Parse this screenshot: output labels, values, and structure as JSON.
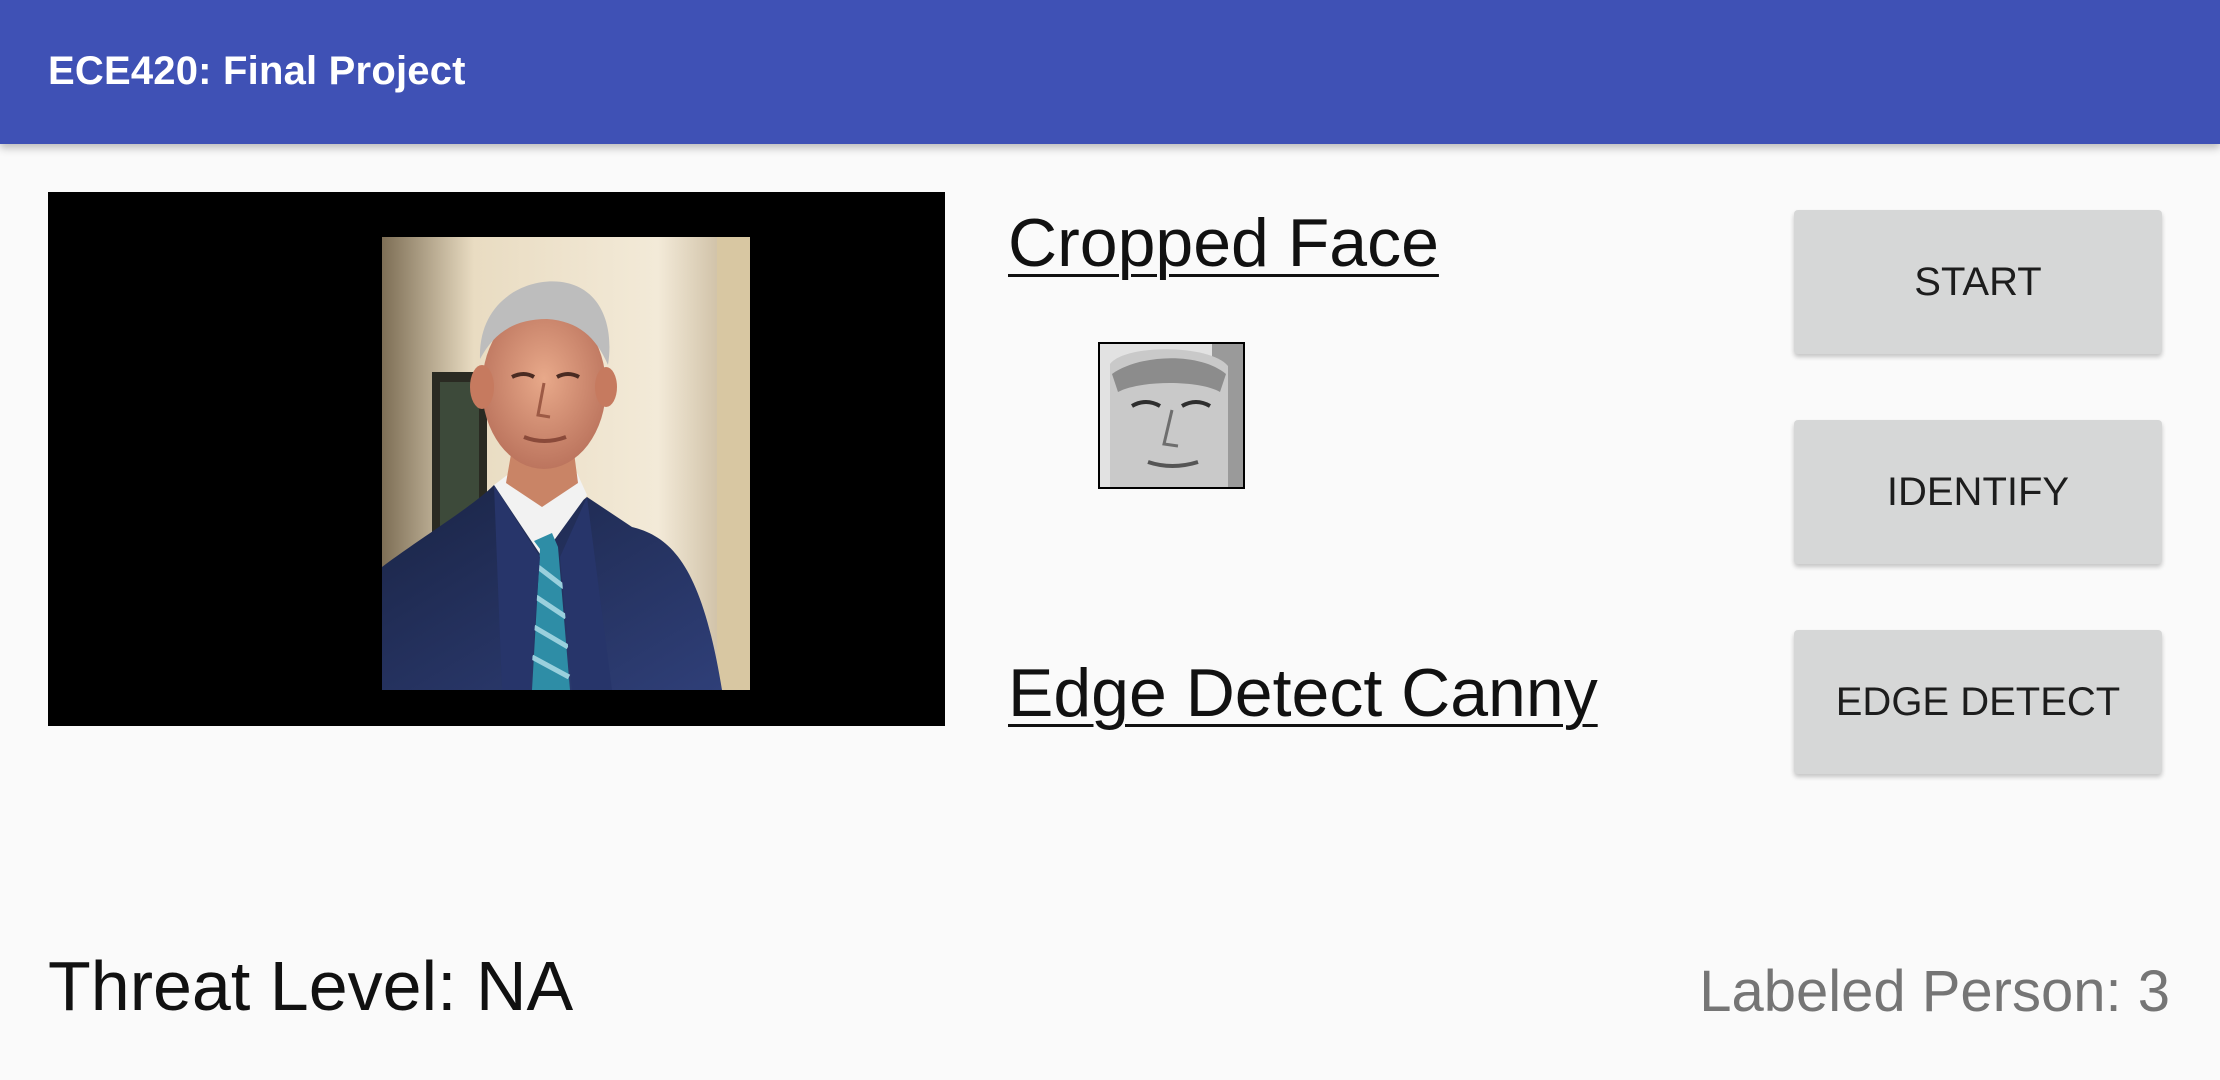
{
  "app_bar": {
    "title": "ECE420: Final Project",
    "color": "#3f51b5"
  },
  "camera": {
    "icon": "portrait-photo"
  },
  "cropped_face": {
    "title": "Cropped Face",
    "icon": "grayscale-face-thumbnail"
  },
  "edge_detect": {
    "title": "Edge Detect Canny"
  },
  "buttons": {
    "start": "START",
    "identify": "IDENTIFY",
    "edge_detect": "EDGE DETECT"
  },
  "status": {
    "threat_level": "Threat Level: NA",
    "labeled_person": "Labeled Person: 3"
  }
}
